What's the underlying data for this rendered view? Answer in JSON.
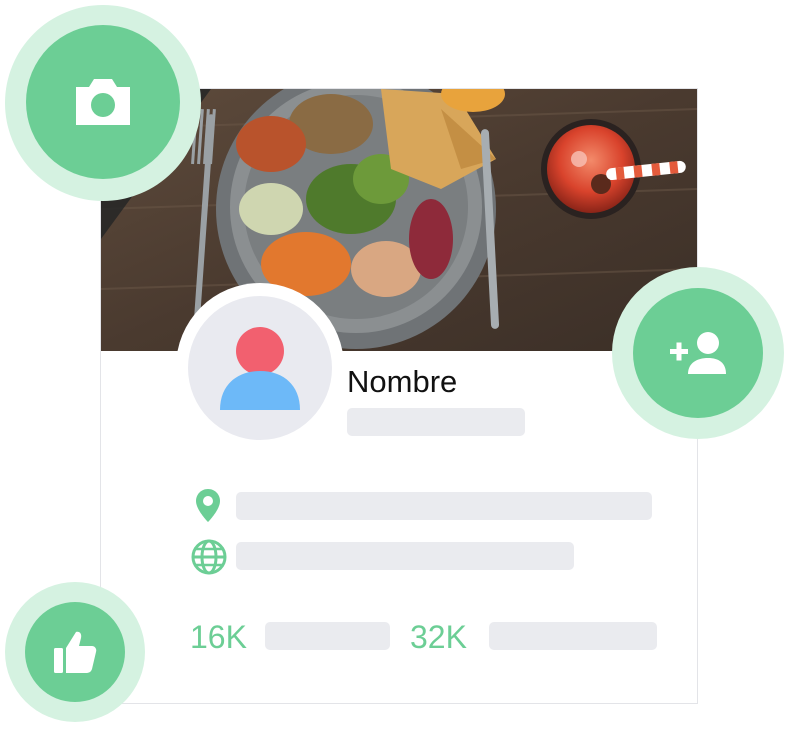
{
  "profile": {
    "name": "Nombre",
    "followers": "16K",
    "following": "32K"
  },
  "icons": {
    "camera": "camera-icon",
    "add_friend": "add-user-icon",
    "like": "thumbs-up-icon",
    "location": "location-pin-icon",
    "website": "globe-icon",
    "avatar": "user-silhouette-icon"
  },
  "colors": {
    "accent": "#6cce95",
    "accent_halo": "#d5f2e1",
    "placeholder": "#eaebef",
    "avatar_bg": "#e9eaf0",
    "avatar_head": "#f2606f",
    "avatar_body": "#6db9f8"
  }
}
